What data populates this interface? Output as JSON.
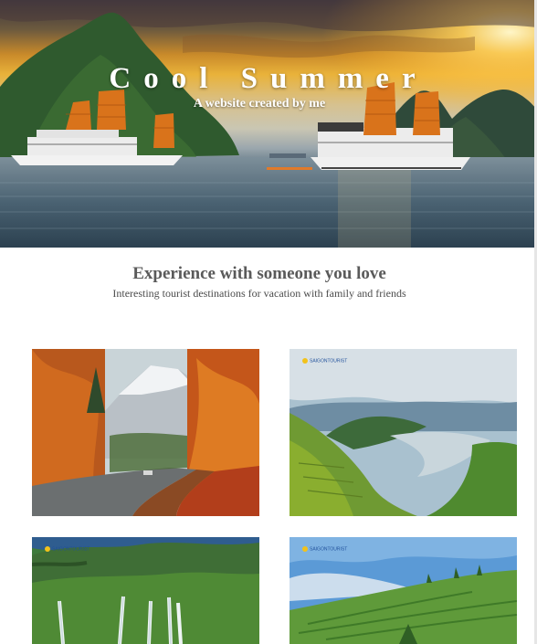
{
  "hero": {
    "title": "Cool Summer",
    "subtitle": "A website created by me"
  },
  "intro": {
    "heading": "Experience with someone you love",
    "subheading": "Interesting tourist destinations for vacation with family and friends"
  },
  "gallery": {
    "items": [
      {
        "scene": "autumn-mountain-road"
      },
      {
        "scene": "river-valley-hills",
        "watermark": "SAIGONTOURIST"
      },
      {
        "scene": "waterfall-forest",
        "watermark": "SAIGONTOURIST"
      },
      {
        "scene": "tea-plantation",
        "watermark": "SAIGONTOURIST"
      }
    ]
  },
  "colors": {
    "heading": "#5a5a5a",
    "text": "#4b4b4b",
    "sail": "#d9731b"
  }
}
